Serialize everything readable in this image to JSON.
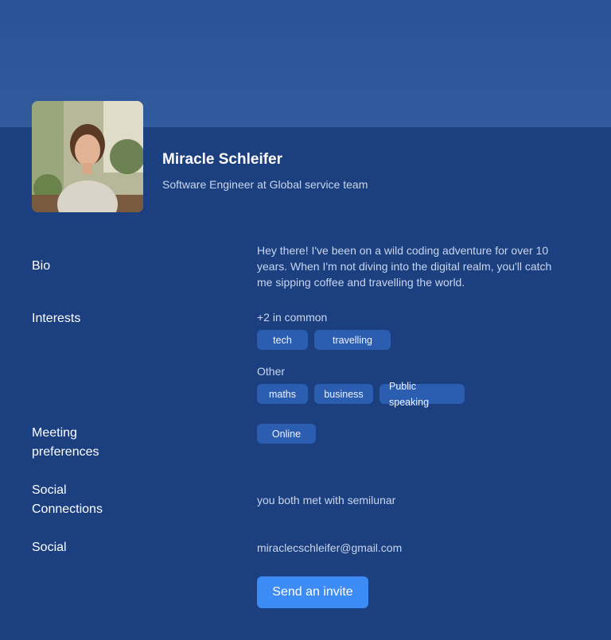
{
  "profile": {
    "name": "Miracle Schleifer",
    "title": "Software Engineer at Global service team"
  },
  "bio": {
    "label": "Bio",
    "text": "Hey there! I've been on a wild coding adventure for over 10 years. When I'm not diving into the digital realm, you'll catch me sipping coffee and travelling the world."
  },
  "interests": {
    "label": "Interests",
    "common_title": "+2 in common",
    "common": [
      "tech",
      "travelling"
    ],
    "other_title": "Other",
    "other": [
      "maths",
      "business",
      "Public speaking"
    ]
  },
  "meeting": {
    "label_line1": "Meeting",
    "label_line2": "preferences",
    "options": [
      "Online"
    ]
  },
  "social_connections": {
    "label_line1": "Social",
    "label_line2": "Connections",
    "text": "you both met with semilunar"
  },
  "social": {
    "label": "Social",
    "email": "miraclecschleifer@gmail.com"
  },
  "actions": {
    "invite_label": "Send an invite"
  },
  "colors": {
    "background": "#1b3f7f",
    "banner": "#2d5698",
    "chip": "#2b5db1",
    "button": "#3d8bf5"
  }
}
